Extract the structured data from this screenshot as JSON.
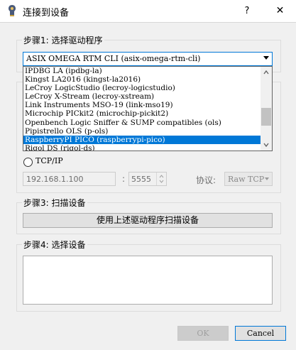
{
  "window": {
    "title": "连接到设备",
    "help_label": "?",
    "close_label": "✕"
  },
  "step1": {
    "title": "步骤1: 选择驱动程序",
    "combo_value": "ASIX OMEGA RTM CLI (asix-omega-rtm-cli)",
    "dropdown_items": [
      "IPDBG LA (ipdbg-la)",
      "Kingst LA2016 (kingst-la2016)",
      "LeCroy LogicStudio (lecroy-logicstudio)",
      "LeCroy X-Stream (lecroy-xstream)",
      "Link Instruments MSO-19 (link-mso19)",
      "Microchip PICkit2 (microchip-pickit2)",
      "Openbench Logic Sniffer & SUMP compatibles (ols)",
      "Pipistrello OLS (p-ols)",
      "RaspberryPI PICO (raspberrypi-pico)",
      "Rigol DS (rigol-ds)"
    ],
    "selected_index": 8
  },
  "step2": {
    "tcp_label": "TCP/IP",
    "ip_value": "192.168.1.100",
    "separator": ":",
    "port_value": "5555",
    "protocol_label": "协议:",
    "protocol_value": "Raw TCP"
  },
  "step3": {
    "title": "步骤3: 扫描设备",
    "scan_button": "使用上述驱动程序扫描设备"
  },
  "step4": {
    "title": "步骤4: 选择设备"
  },
  "buttons": {
    "ok": "OK",
    "cancel": "Cancel"
  }
}
